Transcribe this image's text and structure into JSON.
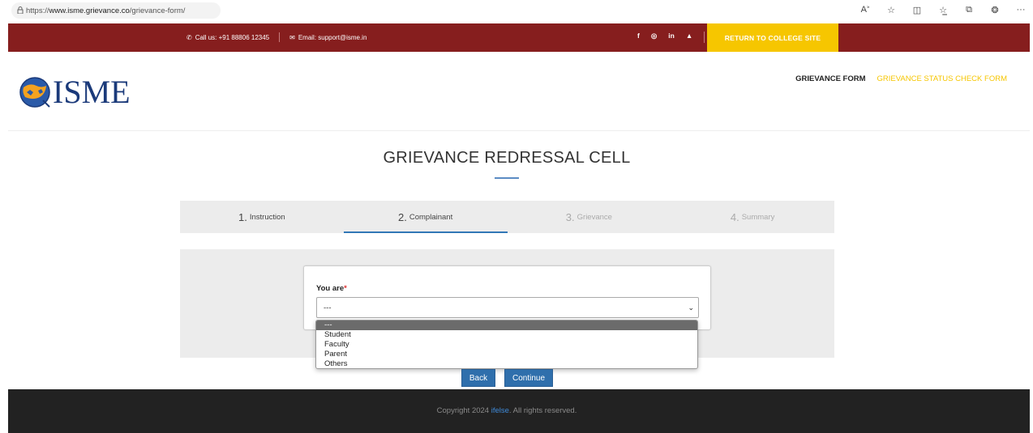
{
  "browser": {
    "url_prefix": "https://",
    "url_host": "www.isme.grievance.co",
    "url_path": "/grievance-form/",
    "icons": [
      "read-aloud-icon",
      "favorite-star-icon",
      "split-screen-icon",
      "favorites-list-icon",
      "collections-icon",
      "extensions-icon",
      "more-icon"
    ]
  },
  "topbar": {
    "phone": "Call us: +91 88806 12345",
    "email": "Email: support@isme.in",
    "socials": [
      "f",
      "◎",
      "in",
      "▲"
    ],
    "return_label": "RETURN TO COLLEGE SITE"
  },
  "header": {
    "logo_text": "ISME",
    "nav": {
      "grievance_form": "GRIEVANCE FORM",
      "status_check": "GRIEVANCE STATUS CHECK FORM"
    }
  },
  "page": {
    "title": "GRIEVANCE REDRESSAL CELL"
  },
  "steps": [
    {
      "num": "1.",
      "label": "Instruction",
      "state": "done"
    },
    {
      "num": "2.",
      "label": "Complainant",
      "state": "active"
    },
    {
      "num": "3.",
      "label": "Grievance",
      "state": "disabled"
    },
    {
      "num": "4.",
      "label": "Summary",
      "state": "disabled"
    }
  ],
  "form": {
    "field_label": "You are",
    "required_mark": "*",
    "selected_value": "---",
    "options": [
      "---",
      "Student",
      "Faculty",
      "Parent",
      "Others"
    ]
  },
  "buttons": {
    "back": "Back",
    "continue": "Continue"
  },
  "footer": {
    "copy_prefix": "Copyright 2024 ",
    "brand": "ifelse",
    "copy_suffix": ". All rights reserved."
  },
  "colors": {
    "topbar": "#861e1e",
    "accent_yellow": "#f6c600",
    "button_blue": "#2f6fac",
    "footer": "#222222"
  }
}
